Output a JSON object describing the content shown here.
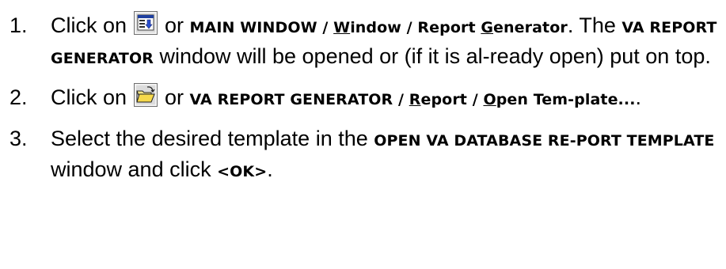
{
  "steps": [
    {
      "num": "1.",
      "t1": "Click on ",
      "icon": "report-generator-window-icon",
      "t2": " or ",
      "b1": "MAIN WINDOW / ",
      "b1u": "W",
      "b1b": "indow / Report ",
      "b1u2": "G",
      "b1c": "enerator",
      "t3": ". The ",
      "b2": "VA REPORT GENERATOR",
      "t4": " window will be opened or (if it is al-ready open) put on top."
    },
    {
      "num": "2.",
      "t1": "Click on ",
      "icon": "open-folder-icon",
      "t2": " or ",
      "b1": "VA REPORT GENERATOR / ",
      "b1u": "R",
      "b1b": "eport / ",
      "b1u2": "O",
      "b1c": "pen Tem-plate...",
      "t3": "."
    },
    {
      "num": "3.",
      "t1": "Select the desired template in the ",
      "b1": "OPEN VA DATABASE RE-PORT TEMPLATE",
      "t2": " window and click ",
      "b2": "<OK>",
      "t3": "."
    }
  ]
}
